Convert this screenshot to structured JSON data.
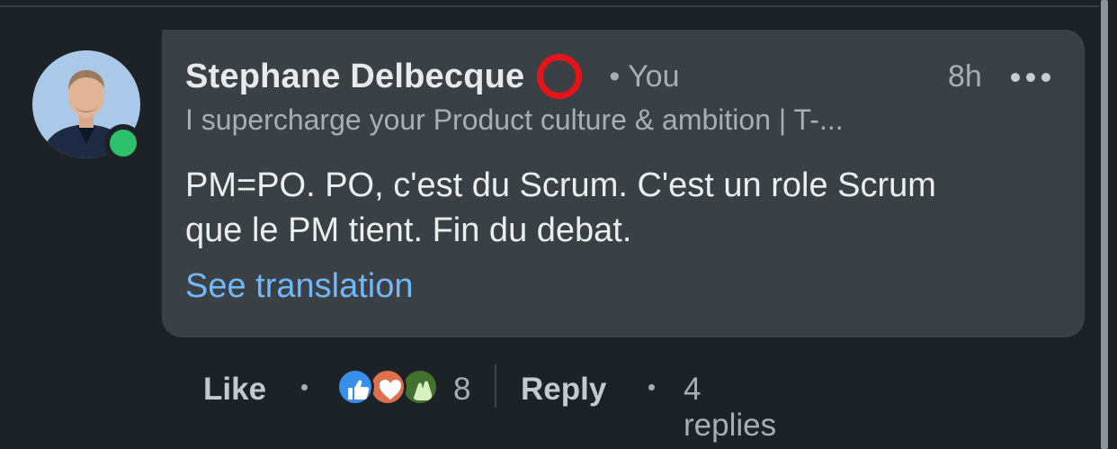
{
  "comment": {
    "author_name": "Stephane Delbecque",
    "relation": "• You",
    "time": "8h",
    "headline": "I supercharge your Product culture & ambition | T-...",
    "body_line1": "PM=PO. PO, c'est du Scrum. C'est un role Scrum",
    "body_line2": "que le PM tient. Fin du debat.",
    "translate_link": "See translation",
    "presence": "online"
  },
  "actions": {
    "like_label": "Like",
    "reaction_count": "8",
    "reply_label": "Reply",
    "replies_label": "4 replies",
    "reactions": [
      "like-icon",
      "love-icon",
      "praise-icon"
    ]
  },
  "colors": {
    "background": "#1d2226",
    "bubble": "#3b4045",
    "link": "#71b7fb",
    "presence": "#2ec16b",
    "badge": "#e5141b"
  }
}
